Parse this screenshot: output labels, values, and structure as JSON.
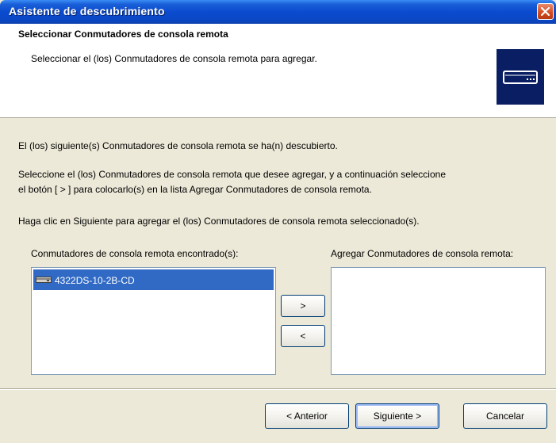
{
  "window": {
    "title": "Asistente de descubrimiento",
    "close_label": "×"
  },
  "header": {
    "title": "Seleccionar Conmutadores de consola remota",
    "subtitle": "Seleccionar el (los) Conmutadores de consola remota para agregar.",
    "icon": "remote-console-switch-icon"
  },
  "body": {
    "line1": "El (los) siguiente(s) Conmutadores de consola remota se ha(n) descubierto.",
    "line2a": "Seleccione el (los) Conmutadores de consola remota que desee agregar, y a continuación seleccione",
    "line2b": "el botón [ > ] para colocarlo(s) en la lista Agregar Conmutadores de consola remota.",
    "line3": "Haga clic en Siguiente para agregar el (los) Conmutadores de consola remota seleccionado(s)."
  },
  "found_list": {
    "label": "Conmutadores de consola remota encontrado(s):",
    "items": [
      {
        "label": "4322DS-10-2B-CD",
        "selected": true,
        "icon": "device-icon"
      }
    ]
  },
  "add_list": {
    "label": "Agregar Conmutadores de consola remota:",
    "items": []
  },
  "transfer": {
    "add_label": ">",
    "remove_label": "<"
  },
  "footer": {
    "back_label": "< Anterior",
    "next_label": "Siguiente >",
    "cancel_label": "Cancelar"
  },
  "colors": {
    "titlebar": "#0a4bcf",
    "selection": "#316ac5",
    "dialog_bg": "#ece9d8"
  }
}
